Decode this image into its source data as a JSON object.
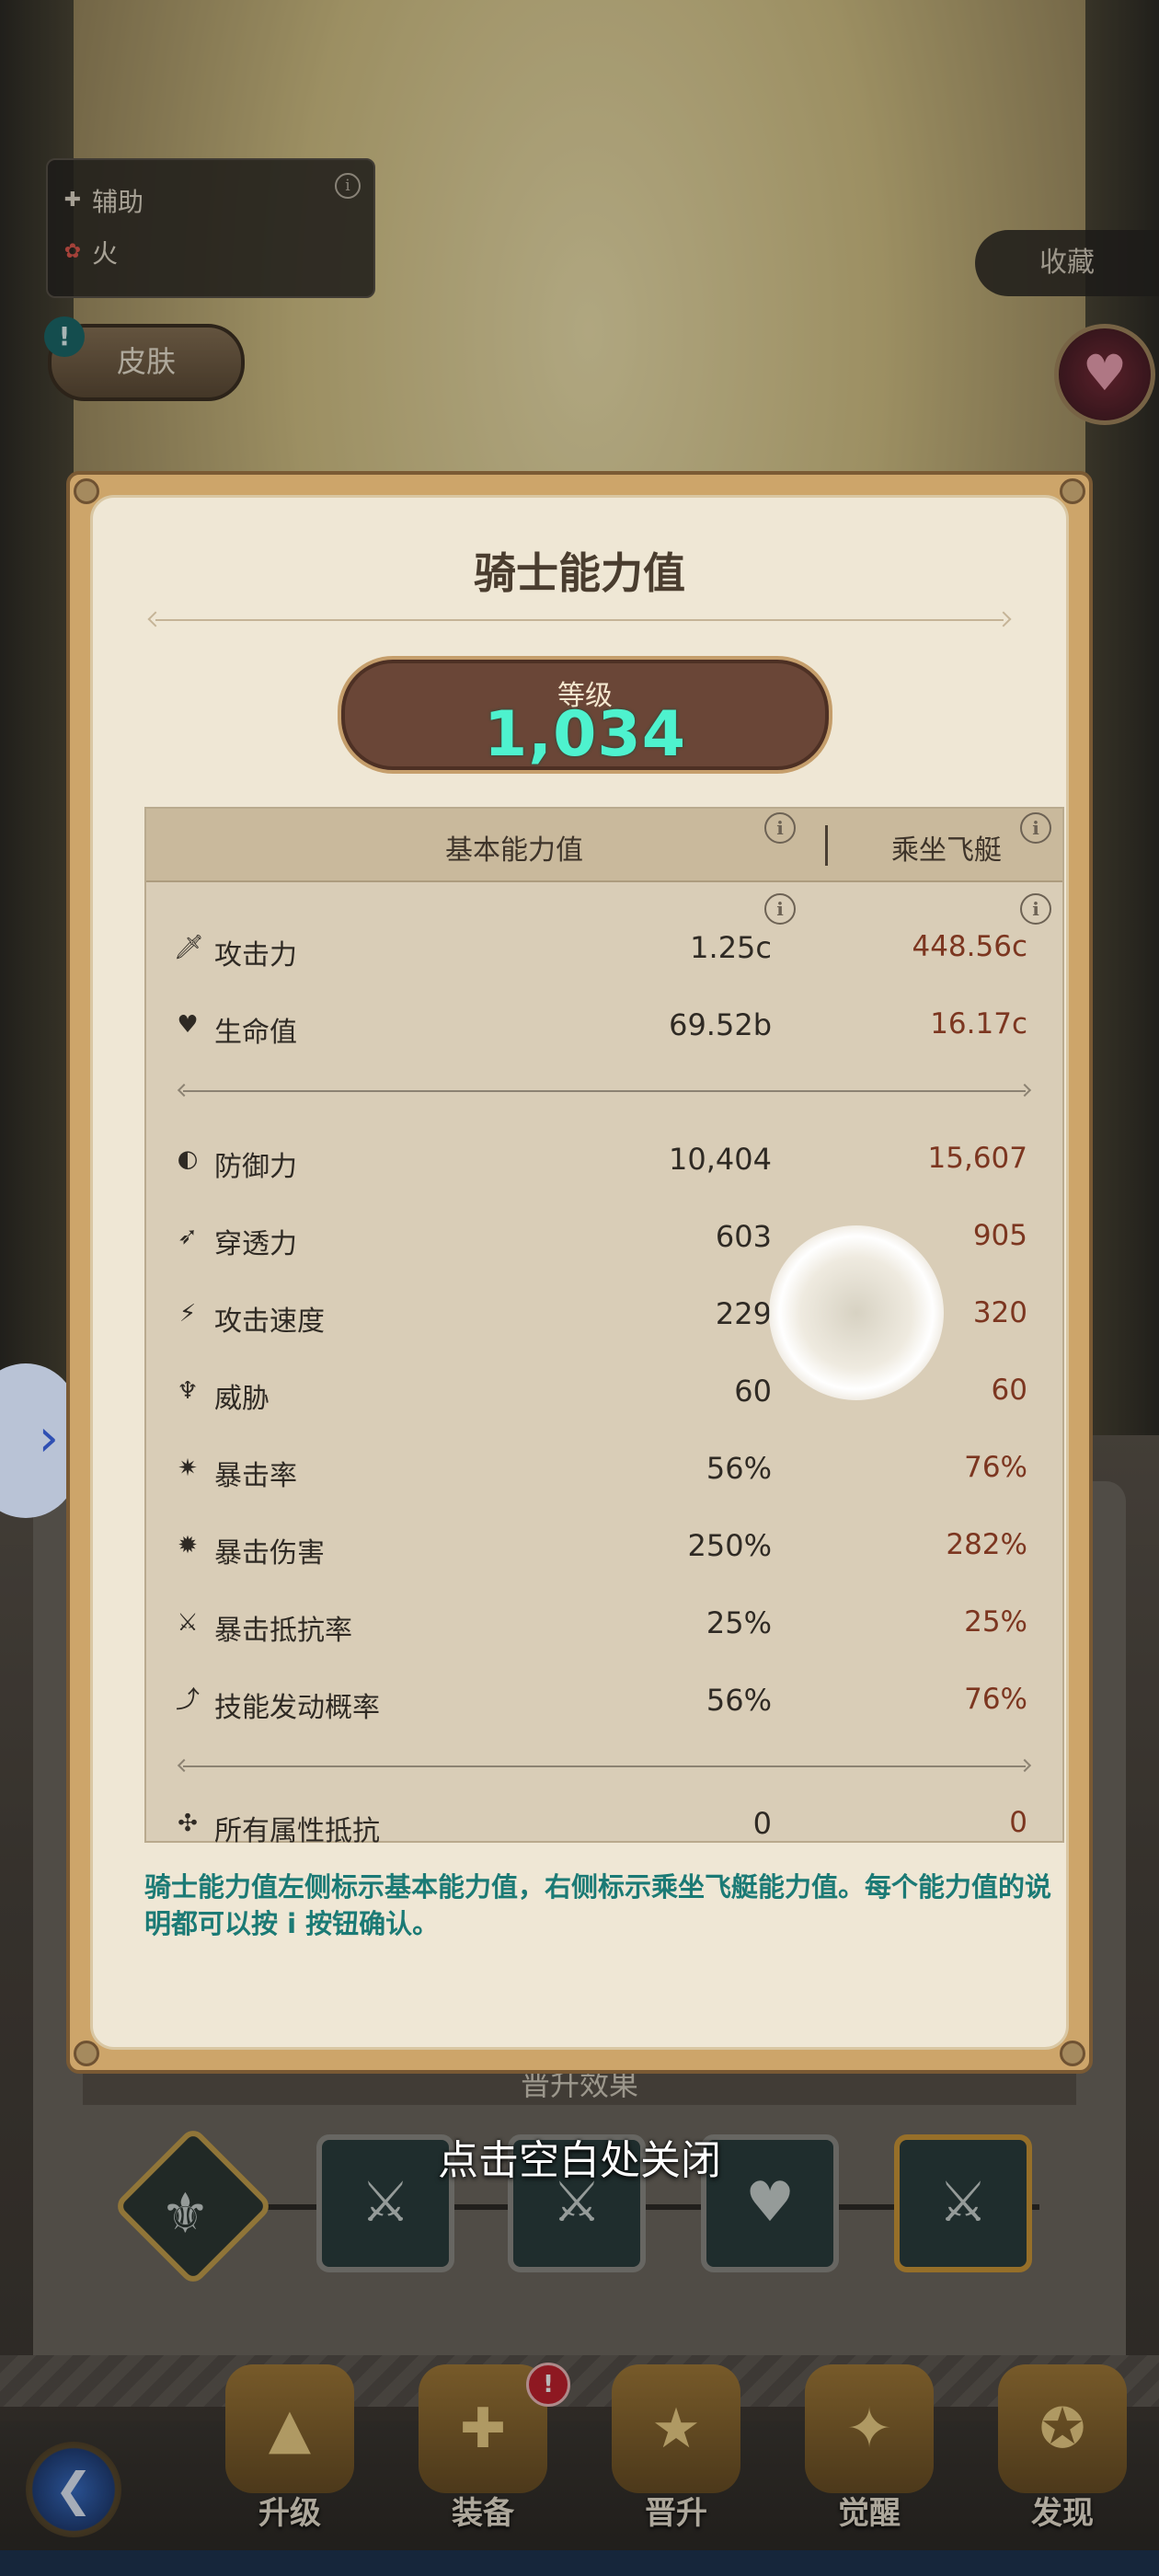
{
  "hero_info": {
    "role": "辅助",
    "element": "火",
    "skin_button": "皮肤",
    "skin_alert": "!",
    "favorite_button": "收藏"
  },
  "modal": {
    "title": "骑士能力值",
    "level_label": "等级",
    "level_value": "1,034",
    "columns": {
      "base": "基本能力值",
      "mount": "乘坐飞艇"
    },
    "stats": [
      {
        "name": "攻击力",
        "icon": "sword-icon",
        "base": "1.25c",
        "mount": "448.56c"
      },
      {
        "name": "生命值",
        "icon": "heart-icon",
        "base": "69.52b",
        "mount": "16.17c"
      },
      {
        "name": "防御力",
        "icon": "shield-icon",
        "base": "10,404",
        "mount": "15,607"
      },
      {
        "name": "穿透力",
        "icon": "pierce-icon",
        "base": "603",
        "mount": "905"
      },
      {
        "name": "攻击速度",
        "icon": "attack-speed-icon",
        "base": "229",
        "mount": "320"
      },
      {
        "name": "威胁",
        "icon": "threat-icon",
        "base": "60",
        "mount": "60"
      },
      {
        "name": "暴击率",
        "icon": "crit-rate-icon",
        "base": "56%",
        "mount": "76%"
      },
      {
        "name": "暴击伤害",
        "icon": "crit-damage-icon",
        "base": "250%",
        "mount": "282%"
      },
      {
        "name": "暴击抵抗率",
        "icon": "crit-resist-icon",
        "base": "25%",
        "mount": "25%"
      },
      {
        "name": "技能发动概率",
        "icon": "skill-chance-icon",
        "base": "56%",
        "mount": "76%"
      },
      {
        "name": "所有属性抵抗",
        "icon": "element-resist-icon",
        "base": "0",
        "mount": "0"
      }
    ],
    "note": "骑士能力值左侧标示基本能力值，右侧标示乘坐飞艇能力值。每个能力值的说明都可以按 i 按钮确认。"
  },
  "promotion": {
    "title": "晋升效果"
  },
  "close_hint": "点击空白处关闭",
  "nav": {
    "items": [
      "升级",
      "装备",
      "晋升",
      "觉醒",
      "发现"
    ],
    "badge": "!"
  },
  "colors": {
    "level_value": "#4ef2ce",
    "mount_value": "#7c3620",
    "note_text": "#1b7a75",
    "modal_frame": "#cda56a"
  }
}
